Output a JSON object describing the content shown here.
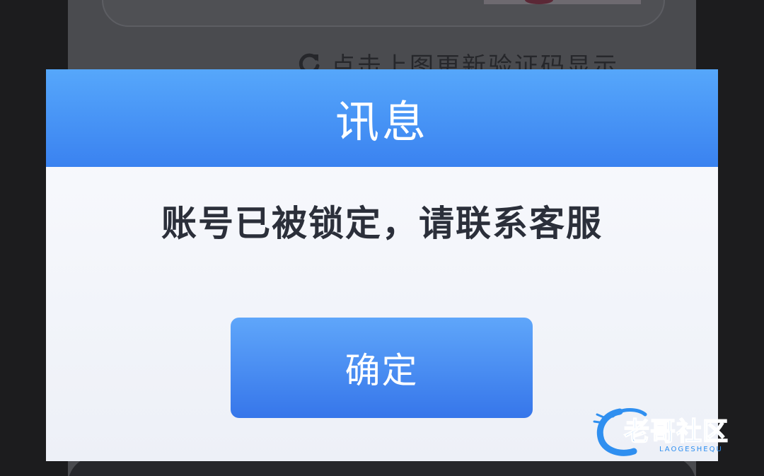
{
  "background": {
    "refresh_hint": "点击上图更新验证码显示"
  },
  "dialog": {
    "title": "讯息",
    "message": "账号已被锁定，请联系客服",
    "confirm_label": "确定"
  },
  "watermark": {
    "text": "老哥社区",
    "subtext": "LAOGESHEQU"
  },
  "colors": {
    "header_top": "#56a7fb",
    "header_bottom": "#3a82f0",
    "button_top": "#5fa6fa",
    "button_bottom": "#3676ea",
    "message_text": "#2b2f3a"
  },
  "icons": [
    "refresh-icon",
    "dragon-logo-icon"
  ]
}
